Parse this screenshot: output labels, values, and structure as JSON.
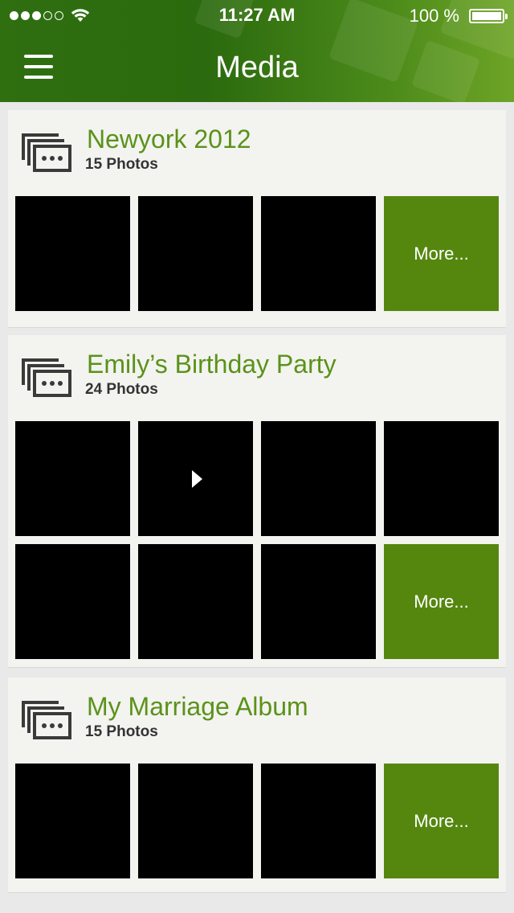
{
  "status": {
    "time": "11:27 AM",
    "battery": "100 %"
  },
  "header": {
    "title": "Media"
  },
  "albums": [
    {
      "name": "Newyork 2012",
      "count": "15 Photos",
      "more": "More..."
    },
    {
      "name": "Emily’s Birthday Party",
      "count": "24 Photos",
      "more": "More..."
    },
    {
      "name": "My Marriage Album",
      "count": "15 Photos",
      "more": "More..."
    }
  ],
  "colors": {
    "accent": "#5b9219",
    "more_tile": "#55870f",
    "header": "#2f6f10"
  },
  "icons": [
    "signal-dots-icon",
    "wifi-icon",
    "battery-icon",
    "hamburger-menu-icon",
    "album-stack-icon",
    "play-icon"
  ]
}
